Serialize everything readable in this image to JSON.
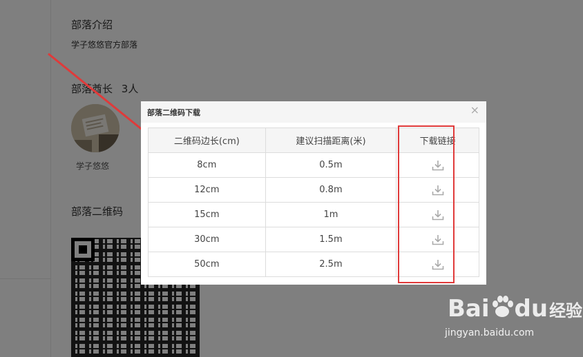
{
  "page": {
    "intro_title": "部落介绍",
    "intro_text": "学子悠悠官方部落",
    "chief_title": "部落酋长",
    "chief_count": "3人",
    "chief_name": "学子悠悠",
    "qrcode_title": "部落二维码"
  },
  "modal": {
    "title": "部落二维码下载",
    "close": "×",
    "headers": [
      "二维码边长(cm)",
      "建议扫描距离(米)",
      "下载链接"
    ],
    "rows": [
      {
        "size": "8cm",
        "distance": "0.5m",
        "icon": "download-icon"
      },
      {
        "size": "12cm",
        "distance": "0.8m",
        "icon": "download-icon"
      },
      {
        "size": "15cm",
        "distance": "1m",
        "icon": "download-icon"
      },
      {
        "size": "30cm",
        "distance": "1.5m",
        "icon": "download-icon"
      },
      {
        "size": "50cm",
        "distance": "2.5m",
        "icon": "download-icon"
      }
    ]
  },
  "watermark": {
    "logo_latin_1": "Bai",
    "logo_latin_2": "du",
    "logo_cn": "经验",
    "url": "jingyan.baidu.com"
  },
  "colors": {
    "overlay": "#000000",
    "annotation": "#e03a3a",
    "header_bg": "#f5f5f5",
    "icon": "#aaaaaa"
  }
}
